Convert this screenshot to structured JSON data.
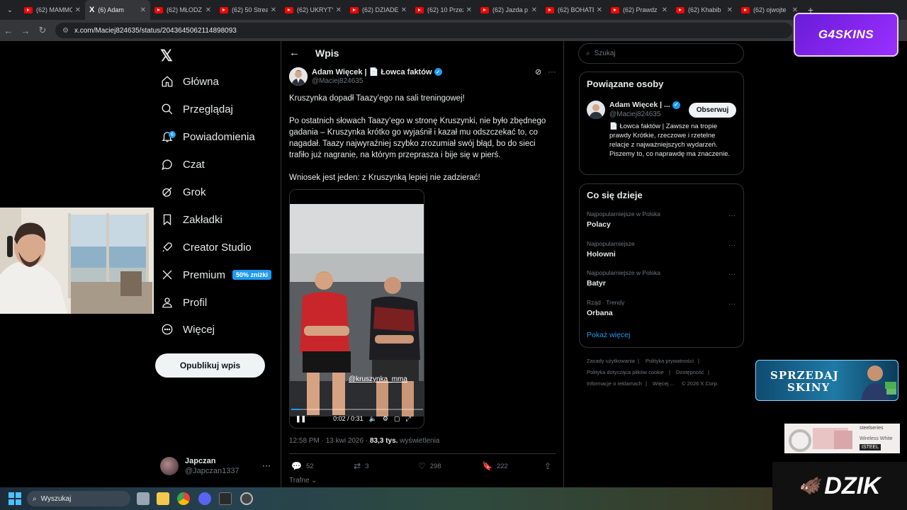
{
  "browser": {
    "tabs": [
      {
        "title": "(62) MAMMO",
        "icon": "youtube-icon",
        "active": false
      },
      {
        "title": "(6) Adam",
        "icon": "x-icon",
        "active": true
      },
      {
        "title": "(62) MŁODZ",
        "icon": "youtube-icon",
        "active": false
      },
      {
        "title": "(62) 50 Strea",
        "icon": "youtube-icon",
        "active": false
      },
      {
        "title": "(62) UKRYTY",
        "icon": "youtube-icon",
        "active": false
      },
      {
        "title": "(62) DZIADE",
        "icon": "youtube-icon",
        "active": false
      },
      {
        "title": "(62) 10 Przez",
        "icon": "youtube-icon",
        "active": false
      },
      {
        "title": "(62) Jazda p",
        "icon": "youtube-icon",
        "active": false
      },
      {
        "title": "(62) BOHATE",
        "icon": "youtube-icon",
        "active": false
      },
      {
        "title": "(62) Prawdz",
        "icon": "youtube-icon",
        "active": false
      },
      {
        "title": "(62) Khabib",
        "icon": "youtube-icon",
        "active": false
      },
      {
        "title": "(62) ojwojte",
        "icon": "youtube-icon",
        "active": false
      }
    ],
    "url": "x.com/Maciej824635/status/2043645062114898093"
  },
  "overlays": {
    "g4skins": "G4SKINS",
    "sprzedaj_line1": "SPRZEDAJ",
    "sprzedaj_line2": "SKINY",
    "steel_brand": "steelseries",
    "steel_product": "Wireless White",
    "steel_tag": "ISTEEL",
    "dzik": "DZIK"
  },
  "nav": {
    "items": [
      {
        "label": "Główna",
        "icon": "home-icon"
      },
      {
        "label": "Przeglądaj",
        "icon": "search-icon"
      },
      {
        "label": "Powiadomienia",
        "icon": "bell-icon",
        "badge": "6"
      },
      {
        "label": "Czat",
        "icon": "chat-icon"
      },
      {
        "label": "Grok",
        "icon": "grok-icon"
      },
      {
        "label": "Zakładki",
        "icon": "bookmark-icon"
      },
      {
        "label": "Creator Studio",
        "icon": "rocket-icon"
      },
      {
        "label": "Premium",
        "icon": "x-premium-icon",
        "promo": "50% zniżki"
      },
      {
        "label": "Profil",
        "icon": "person-icon"
      },
      {
        "label": "Więcej",
        "icon": "more-circle-icon"
      }
    ],
    "post_button": "Opublikuj wpis",
    "account": {
      "name": "Japczan",
      "handle": "@Japczan1337"
    }
  },
  "main": {
    "title": "Wpis",
    "author": {
      "name": "Adam Więcek | 📄 Łowca faktów",
      "handle": "@Maciej824635"
    },
    "paragraphs": [
      "Kruszynka dopadł Taazy’ego na sali treningowej!",
      "Po ostatnich słowach Taazy’ego w stronę Kruszynki, nie było zbędnego gadania – Kruszynka krótko go wyjaśnił i kazał mu odszczekać to, co nagadał. Taazy najwyraźniej szybko zrozumiał swój błąd, bo do sieci trafiło już nagranie, na którym przeprasza i bije się w pierś.",
      "Wniosek jest jeden: z Kruszynką lepiej nie zadzierać!"
    ],
    "video": {
      "watermark": "@kruszynka_mma",
      "time": "0:02 / 0:31",
      "progress": 0.065
    },
    "meta": {
      "time": "12:58 PM · 13 kwi 2026 · ",
      "views": "83,3 tys.",
      "views_label": " wyświetlenia"
    },
    "stats": {
      "replies": "52",
      "reposts": "3",
      "likes": "298",
      "bookmarks": "222"
    },
    "sort_label": "Trafne"
  },
  "right": {
    "search_placeholder": "Szukaj",
    "related": {
      "title": "Powiązane osoby",
      "name": "Adam Więcek | ...",
      "handle": "@Maciej824635",
      "follow": "Obserwuj",
      "bio": "📄 Łowca faktów | Zawsze na tropie prawdy Krótkie, rzeczowe i rzetelne relacje z najważniejszych wydarzeń. Piszemy to, co naprawdę ma znaczenie."
    },
    "trends": {
      "title": "Co się dzieje",
      "items": [
        {
          "category": "Najpopularniejsze w Polska",
          "name": "Polacy"
        },
        {
          "category": "Najpopularniejsze",
          "name": "Holowni"
        },
        {
          "category": "Najpopularniejsze w Polska",
          "name": "Batyr"
        },
        {
          "category": "Rząd · Trendy",
          "name": "Orbana"
        }
      ],
      "show_more": "Pokaż więcej"
    },
    "footer": {
      "terms": "Zasady użytkowania",
      "privacy": "Polityka prywatności",
      "cookies": "Polityka dotycząca plików cookie",
      "accessibility": "Dostępność",
      "ads": "Informacje o reklamach",
      "more": "Więcej ...",
      "copyright": "© 2026 X Corp."
    }
  },
  "taskbar": {
    "search": "Wyszukaj"
  }
}
